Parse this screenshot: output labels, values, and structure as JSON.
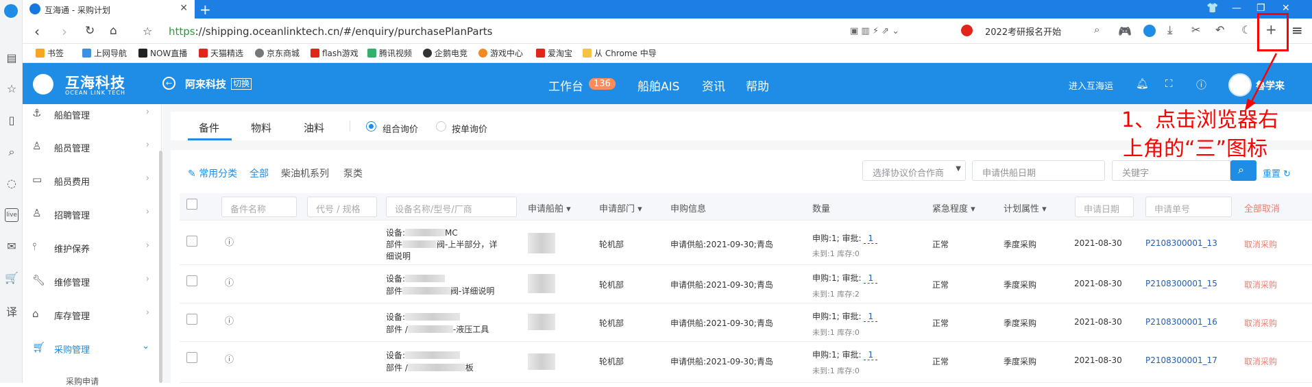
{
  "browser": {
    "tab_title": "互海通 - 采购计划",
    "url_https": "https",
    "url_rest": "://shipping.oceanlinktech.cn/#/enquiry/purchasePlanParts",
    "search_text": "2022考研报名开始",
    "bookmarks": [
      {
        "label": "书签",
        "color": "#f5a623"
      },
      {
        "label": "上网导航",
        "color": "#3d8fe0"
      },
      {
        "label": "NOW直播",
        "color": "#222222"
      },
      {
        "label": "天猫精选",
        "color": "#e1251b"
      },
      {
        "label": "京东商城",
        "color": "#777777"
      },
      {
        "label": "flash游戏",
        "color": "#e1251b"
      },
      {
        "label": "腾讯视频",
        "color": "#32b16c"
      },
      {
        "label": "企鹅电竞",
        "color": "#333333"
      },
      {
        "label": "游戏中心",
        "color": "#f08a24"
      },
      {
        "label": "爱淘宝",
        "color": "#e1251b"
      },
      {
        "label": "从 Chrome 中导",
        "color": "#f5c342"
      }
    ]
  },
  "app": {
    "logo_cn": "互海科技",
    "logo_en": "OCEAN LINK TECH",
    "company": "阿来科技",
    "switch": "切换",
    "nav": [
      {
        "label": "工作台"
      },
      {
        "label": "船舶AIS"
      },
      {
        "label": "资讯"
      },
      {
        "label": "帮助"
      }
    ],
    "workbench_badge": "136",
    "enter": "进入互海运",
    "user": "魯学来"
  },
  "sidebar": {
    "items": [
      {
        "label": "船舶管理",
        "icon": "anchor-icon"
      },
      {
        "label": "船员管理",
        "icon": "person-icon"
      },
      {
        "label": "船员费用",
        "icon": "wallet-icon"
      },
      {
        "label": "招聘管理",
        "icon": "recruit-icon"
      },
      {
        "label": "维护保养",
        "icon": "maintenance-icon"
      },
      {
        "label": "维修管理",
        "icon": "wrench-icon"
      },
      {
        "label": "库存管理",
        "icon": "warehouse-icon"
      },
      {
        "label": "采购管理",
        "icon": "cart-icon"
      }
    ],
    "sub_item": "采购申请"
  },
  "tabs": {
    "items": [
      "备件",
      "物料",
      "油料"
    ],
    "radio1": "组合询价",
    "radio2": "按单询价"
  },
  "filters": {
    "common": "常用分类",
    "all": "全部",
    "diesel": "柴油机系列",
    "pump": "泵类",
    "agreement_placeholder": "选择协议价合作商",
    "date_placeholder": "申请供船日期",
    "keyword_placeholder": "关键字",
    "reset": "重置"
  },
  "table": {
    "ph_name": "备件名称",
    "ph_code": "代号 / 规格",
    "ph_device": "设备名称/型号/厂商",
    "h_ship": "申请船舶",
    "h_dept": "申请部门",
    "h_info": "申购信息",
    "h_qty": "数量",
    "h_urgency": "紧急程度",
    "h_plan": "计划属性",
    "ph_date": "申请日期",
    "ph_no": "申请单号",
    "cancel_all": "全部取消",
    "rows": [
      {
        "dev1": "设备:",
        "dev1b": "MC",
        "dev2": "部件",
        "dev2b": "阀-上半部分，详",
        "dev3": "细说明",
        "dept": "轮机部",
        "info": "申请供船:2021-09-30;青岛",
        "qty1": "申购:1; 审批:",
        "qty_val": "1",
        "qty2": "未到:1 库存:0",
        "urgency": "正常",
        "plan": "季度采购",
        "date": "2021-08-30",
        "no": "P2108300001_13",
        "cancel": "取消采购"
      },
      {
        "dev1": "设备:",
        "dev1b": "",
        "dev2": "部件",
        "dev2b": "阀-详细说明",
        "dev3": "",
        "dept": "轮机部",
        "info": "申请供船:2021-09-30;青岛",
        "qty1": "申购:1; 审批:",
        "qty_val": "1",
        "qty2": "未到:1 库存:2",
        "urgency": "正常",
        "plan": "季度采购",
        "date": "2021-08-30",
        "no": "P2108300001_15",
        "cancel": "取消采购"
      },
      {
        "dev1": "设备:",
        "dev1b": "",
        "dev2": "部件 /",
        "dev2b": "-液压工具",
        "dev3": "",
        "dept": "轮机部",
        "info": "申请供船:2021-09-30;青岛",
        "qty1": "申购:1; 审批:",
        "qty_val": "1",
        "qty2": "未到:1 库存:0",
        "urgency": "正常",
        "plan": "季度采购",
        "date": "2021-08-30",
        "no": "P2108300001_16",
        "cancel": "取消采购"
      },
      {
        "dev1": "设备:",
        "dev1b": "",
        "dev2": "部件 /",
        "dev2b": "板",
        "dev3": "",
        "dept": "轮机部",
        "info": "申请供船:2021-09-30;青岛",
        "qty1": "申购:1; 审批:",
        "qty_val": "1",
        "qty2": "未到:1 库存:0",
        "urgency": "正常",
        "plan": "季度采购",
        "date": "2021-08-30",
        "no": "P2108300001_17",
        "cancel": "取消采购"
      }
    ]
  },
  "annotation": {
    "line1": "1、点击浏览器右",
    "line2": "上角的“三”图标"
  }
}
